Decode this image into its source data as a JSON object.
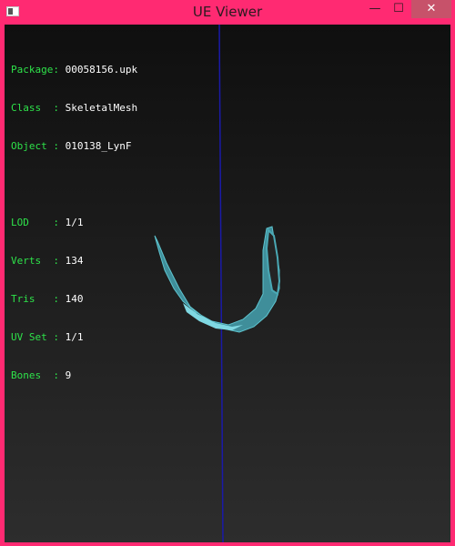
{
  "window": {
    "title": "UE Viewer",
    "controls": {
      "minimize": "—",
      "maximize": "☐",
      "close": "✕"
    }
  },
  "info": {
    "package_label": "Package:",
    "package_value": "00058156.upk",
    "class_label": "Class  :",
    "class_value": "SkeletalMesh",
    "object_label": "Object :",
    "object_value": "010138_LynF",
    "lod_label": "LOD    :",
    "lod_value": "1/1",
    "verts_label": "Verts  :",
    "verts_value": "134",
    "tris_label": "Tris   :",
    "tris_value": "140",
    "uvset_label": "UV Set :",
    "uvset_value": "1/1",
    "bones_label": "Bones  :",
    "bones_value": "9"
  },
  "colors": {
    "frame": "#ff2a72",
    "info_label": "#2ee34a",
    "info_value": "#ffffff",
    "axis_line": "#1a1aa8",
    "mesh": "#5ec4cf"
  }
}
